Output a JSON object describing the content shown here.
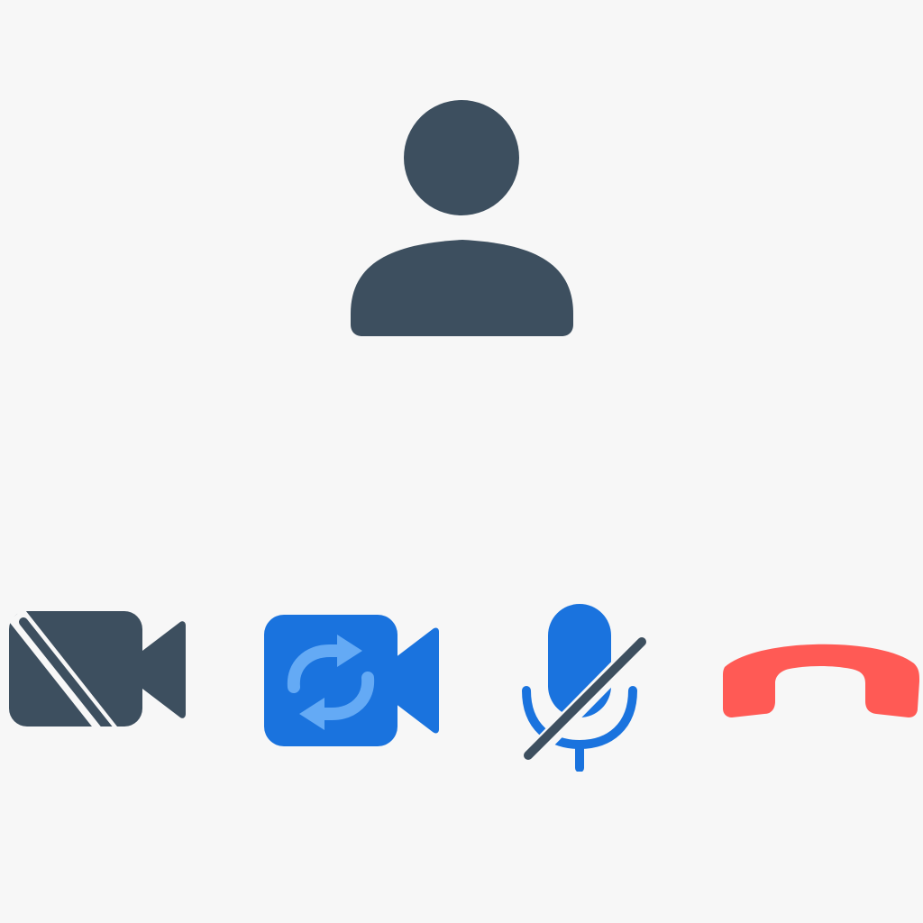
{
  "avatar": {
    "icon": "person-icon",
    "color": "#3d4f5f"
  },
  "controls": [
    {
      "name": "camera-off-button",
      "icon": "video-camera-off-icon",
      "state": "camera off",
      "color": "#3d4f5f"
    },
    {
      "name": "switch-camera-button",
      "icon": "camera-switch-icon",
      "state": "switch camera",
      "color": "#1a73de",
      "accent": "#64aaf5"
    },
    {
      "name": "mute-mic-button",
      "icon": "microphone-off-icon",
      "state": "muted",
      "color": "#1a73de",
      "slash_color": "#3d4f5f"
    },
    {
      "name": "end-call-button",
      "icon": "phone-hangup-icon",
      "state": "end call",
      "color": "#ff5a55"
    }
  ],
  "background": "#f7f7f7"
}
